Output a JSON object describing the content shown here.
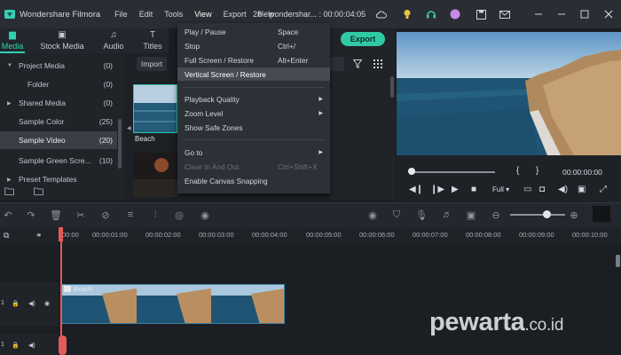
{
  "app": {
    "name": "Wondershare Filmora",
    "document_title": "28 - wondershar... : 00:00:04:05"
  },
  "menu": [
    "File",
    "Edit",
    "Tools",
    "View",
    "Export",
    "Help"
  ],
  "tabs": [
    {
      "label": "Media",
      "icon": "folder-icon"
    },
    {
      "label": "Stock Media",
      "icon": "stock-media-icon"
    },
    {
      "label": "Audio",
      "icon": "music-note-icon"
    },
    {
      "label": "Titles",
      "icon": "text-t-icon"
    }
  ],
  "sidebar": {
    "items": [
      {
        "label": "Project Media",
        "count": "(0)",
        "arrow": "▼"
      },
      {
        "label": "Folder",
        "count": "(0)",
        "arrow": ""
      },
      {
        "label": "Shared Media",
        "count": "(0)",
        "arrow": "▶"
      },
      {
        "label": "Sample Color",
        "count": "(25)",
        "arrow": ""
      },
      {
        "label": "Sample Video",
        "count": "(20)",
        "arrow": ""
      },
      {
        "label": "Sample Green Scre...",
        "count": "(10)",
        "arrow": ""
      },
      {
        "label": "Preset Templates",
        "count": "",
        "arrow": "▶"
      }
    ],
    "selected_index": 4
  },
  "media": {
    "import_label": "Import",
    "thumb_label": "Beach"
  },
  "export_label": "Export",
  "view_menu": {
    "items": [
      {
        "label": "Play / Pause",
        "shortcut": "Space",
        "submenu": false,
        "disabled": false
      },
      {
        "label": "Stop",
        "shortcut": "Ctrl+/",
        "submenu": false,
        "disabled": false
      },
      {
        "label": "Full Screen / Restore",
        "shortcut": "Alt+Enter",
        "submenu": false,
        "disabled": false
      },
      {
        "label": "Vertical Screen / Restore",
        "shortcut": "",
        "submenu": false,
        "disabled": false,
        "highlighted": true
      },
      {
        "label": "Playback Quality",
        "shortcut": "",
        "submenu": true,
        "disabled": false
      },
      {
        "label": "Zoom Level",
        "shortcut": "",
        "submenu": true,
        "disabled": false
      },
      {
        "label": "Show Safe Zones",
        "shortcut": "",
        "submenu": false,
        "disabled": false
      },
      {
        "label": "Go to",
        "shortcut": "",
        "submenu": true,
        "disabled": false
      },
      {
        "label": "Clear In And Out",
        "shortcut": "Ctrl+Shift+X",
        "submenu": false,
        "disabled": true
      },
      {
        "label": "Enable Canvas Snapping",
        "shortcut": "",
        "submenu": false,
        "disabled": false
      }
    ]
  },
  "preview": {
    "timecode": "00:00:00:00",
    "quality": "Full",
    "marker_left": "{",
    "marker_right": "}"
  },
  "timeline": {
    "ticks": [
      "00:00",
      "00:00:01:00",
      "00:00:02:00",
      "00:00:03:00",
      "00:00:04:00",
      "00:00:05:00",
      "00:00:06:00",
      "00:00:07:00",
      "00:00:08:00",
      "00:00:09:00",
      "00:00:10:00"
    ],
    "clip_label": "Beach",
    "track_labels": [
      "1",
      "1"
    ]
  },
  "watermark": {
    "main": "pewarta",
    "suffix": ".co.id"
  },
  "colors": {
    "accent": "#33d1b2",
    "export": "#2fc9a6",
    "playhead": "#e35a5a"
  }
}
